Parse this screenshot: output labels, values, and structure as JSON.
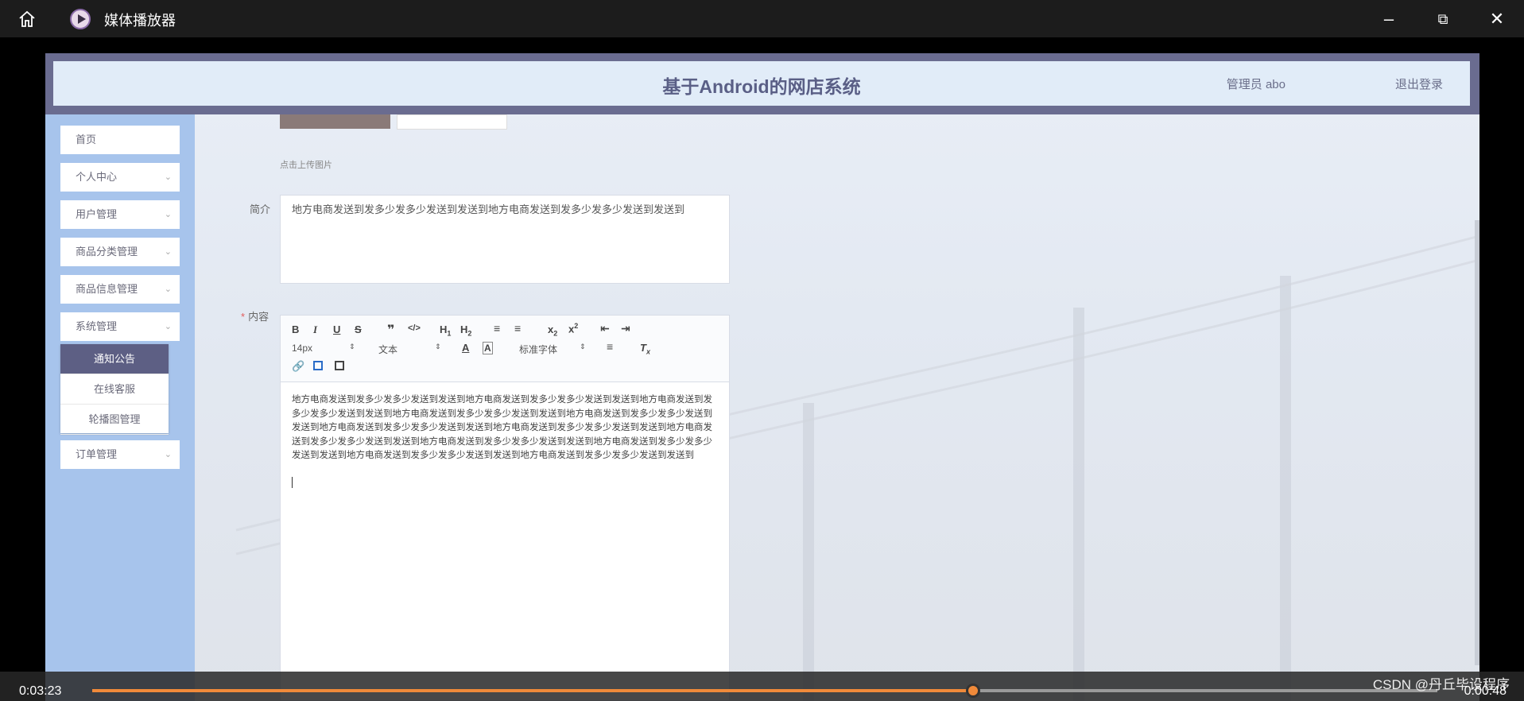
{
  "player": {
    "title": "媒体播放器",
    "time_elapsed": "0:03:23",
    "time_remaining": "0:00:48",
    "progress_fraction": 0.655,
    "watermark": "CSDN @丹丘毕设程序"
  },
  "app": {
    "title": "基于Android的网店系统",
    "user": "管理员 abo",
    "logout": "退出登录"
  },
  "sidebar": {
    "items": [
      {
        "label": "首页",
        "chevron": false
      },
      {
        "label": "个人中心",
        "chevron": true
      },
      {
        "label": "用户管理",
        "chevron": true
      },
      {
        "label": "商品分类管理",
        "chevron": true
      },
      {
        "label": "商品信息管理",
        "chevron": true
      },
      {
        "label": "系统管理",
        "chevron": true
      }
    ],
    "submenu": [
      "通知公告",
      "在线客服",
      "轮播图管理"
    ],
    "last_item": "订单管理"
  },
  "form": {
    "upload_hint": "点击上传图片",
    "intro_label": "简介",
    "intro_value": "地方电商发送到发多少发多少发送到发送到地方电商发送到发多少发多少发送到发送到",
    "content_label": "内容",
    "content_required_mark": "*",
    "toolbar": {
      "size": "14px",
      "header": "文本",
      "font": "标准字体"
    },
    "content_value": "地方电商发送到发多少发多少发送到发送到地方电商发送到发多少发多少发送到发送到地方电商发送到发多少发多少发送到发送到地方电商发送到发多少发多少发送到发送到地方电商发送到发多少发多少发送到发送到地方电商发送到发多少发多少发送到发送到地方电商发送到发多少发多少发送到发送到地方电商发送到发多少发多少发送到发送到地方电商发送到发多少发多少发送到发送到地方电商发送到发多少发多少发送到发送到地方电商发送到发多少发多少发送到发送到地方电商发送到发多少发多少发送到发送到"
  }
}
